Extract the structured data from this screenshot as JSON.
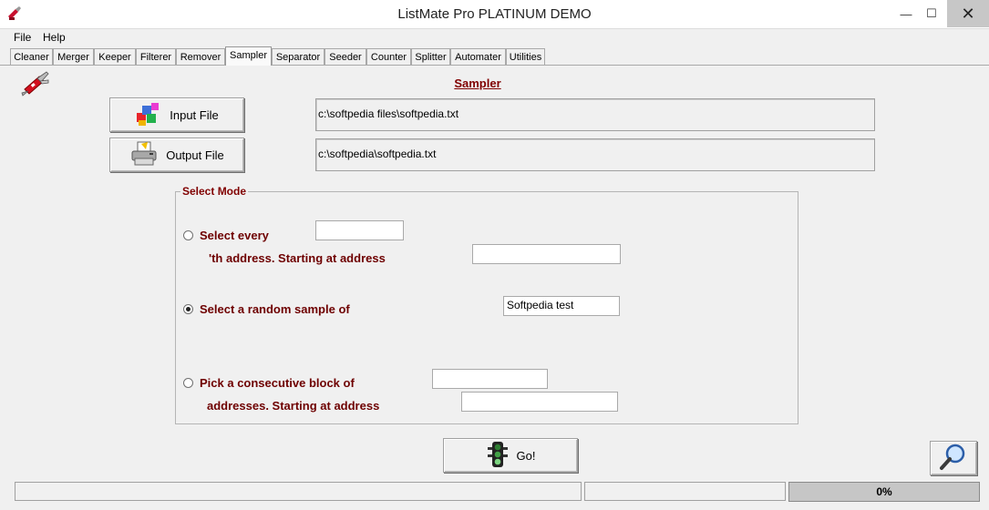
{
  "window": {
    "title": "ListMate Pro PLATINUM DEMO",
    "controls": {
      "minimize": "—",
      "maximize": "☐",
      "close": "✕"
    }
  },
  "menu": [
    "File",
    "Help"
  ],
  "tabs": [
    "Cleaner",
    "Merger",
    "Keeper",
    "Filterer",
    "Remover",
    "Sampler",
    "Separator",
    "Seeder",
    "Counter",
    "Splitter",
    "Automater",
    "Utilities"
  ],
  "active_tab": "Sampler",
  "sampler": {
    "title": "Sampler",
    "input_button": "Input File",
    "input_path": "c:\\softpedia files\\softpedia.txt",
    "output_button": "Output File",
    "output_path": "c:\\softpedia\\softpedia.txt"
  },
  "select_mode": {
    "legend": "Select Mode",
    "every": {
      "label": "Select every",
      "label2": "'th address. Starting at address",
      "value": "",
      "start_value": "",
      "selected": false
    },
    "random": {
      "label": "Select a random sample of",
      "value": "Softpedia test",
      "selected": true
    },
    "block": {
      "label": "Pick a consecutive block of",
      "label2": "addresses. Starting at address",
      "value": "",
      "start_value": "",
      "selected": false
    }
  },
  "actions": {
    "go": "Go!"
  },
  "status": {
    "progress_text": "0%",
    "progress": 0
  },
  "colors": {
    "accent": "#800000",
    "label": "#6e0000",
    "window_bg": "#f0f0f0",
    "progress_bg": "#c6c6c6"
  },
  "icons": [
    "swiss-knife-icon",
    "cubes-icon",
    "printer-icon",
    "traffic-light-icon",
    "magnifier-icon"
  ]
}
